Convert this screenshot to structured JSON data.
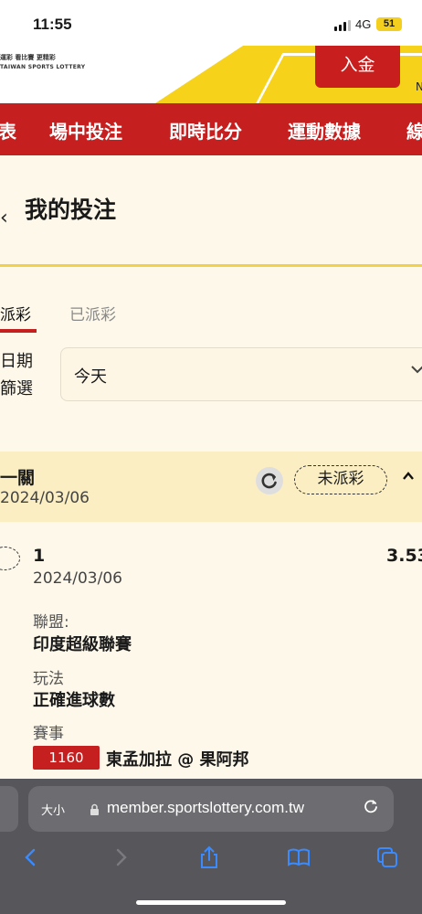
{
  "status_bar": {
    "time": "11:55",
    "network": "4G",
    "battery": "51"
  },
  "header": {
    "logo_line": "運彩 看比賽 更精彩",
    "logo_sub": "TAIWAN SPORTS LOTTERY",
    "deposit_label": "入金",
    "partial_text": "N"
  },
  "nav": {
    "items": [
      "表",
      "場中投注",
      "即時比分",
      "運動數據",
      "線"
    ]
  },
  "page": {
    "back_glyph": "‹",
    "title": "我的投注"
  },
  "tabs": {
    "active": "派彩",
    "inactive": "已派彩"
  },
  "filter": {
    "label_line1": "日期",
    "label_line2": "篩選",
    "selected": "今天"
  },
  "bet_card": {
    "type": "一關",
    "date": "2024/03/06",
    "status": "未派彩",
    "selection": "1",
    "odds": "3.53",
    "selection_date": "2024/03/06",
    "league_label": "聯盟:",
    "league_value": "印度超級聯賽",
    "play_label": "玩法",
    "play_value": "正確進球數",
    "event_label": "賽事",
    "match_code": "1160",
    "match_name": "東孟加拉 @ 果阿邦"
  },
  "browser": {
    "text_size_label": "大小",
    "url": "member.sportslottery.com.tw"
  },
  "colors": {
    "brand_red": "#c61f1f",
    "brand_yellow": "#f6d21a",
    "page_bg": "#fdf8ea"
  },
  "icons": [
    "refresh-icon",
    "chevron-up-icon",
    "chevron-down-icon",
    "lock-icon",
    "reload-icon",
    "back-arrow-icon",
    "forward-arrow-icon",
    "share-icon",
    "bookmarks-icon",
    "tabs-icon"
  ]
}
